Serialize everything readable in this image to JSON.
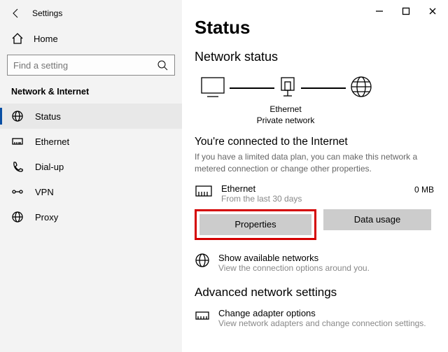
{
  "window": {
    "title": "Settings"
  },
  "sidebar": {
    "home": "Home",
    "search_placeholder": "Find a setting",
    "group": "Network & Internet",
    "items": [
      {
        "label": "Status"
      },
      {
        "label": "Ethernet"
      },
      {
        "label": "Dial-up"
      },
      {
        "label": "VPN"
      },
      {
        "label": "Proxy"
      }
    ]
  },
  "main": {
    "title": "Status",
    "section": "Network status",
    "diagram": {
      "label1": "Ethernet",
      "label2": "Private network"
    },
    "connected_title": "You're connected to the Internet",
    "connected_desc": "If you have a limited data plan, you can make this network a metered connection or change other properties.",
    "conn": {
      "name": "Ethernet",
      "sub": "From the last 30 days",
      "usage": "0 MB"
    },
    "buttons": {
      "properties": "Properties",
      "datausage": "Data usage"
    },
    "avail": {
      "title": "Show available networks",
      "sub": "View the connection options around you."
    },
    "advanced": "Advanced network settings",
    "adapter": {
      "title": "Change adapter options",
      "sub": "View network adapters and change connection settings."
    }
  }
}
